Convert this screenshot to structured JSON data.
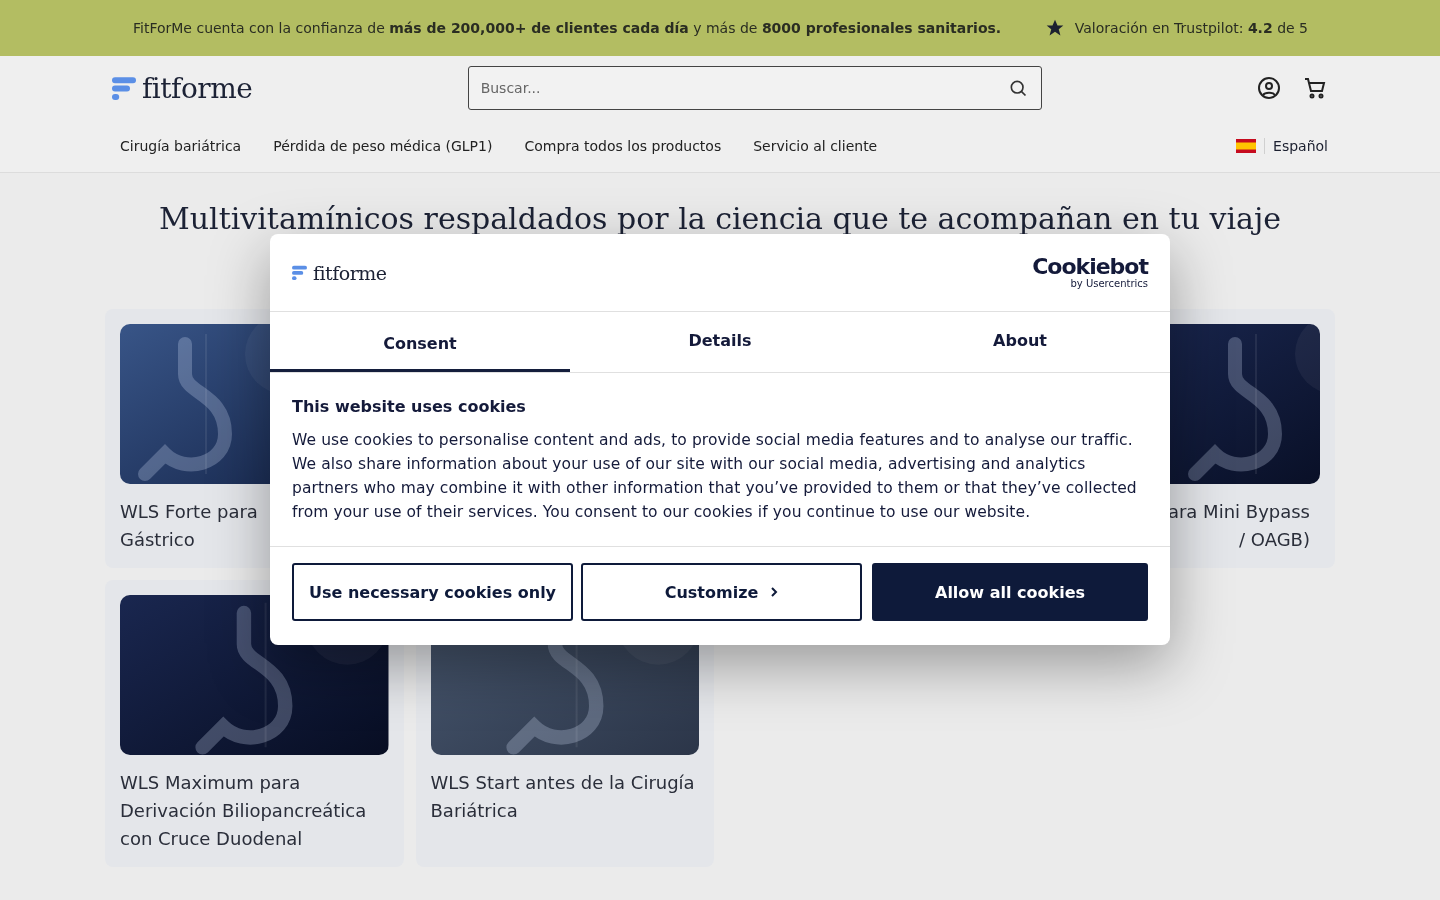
{
  "top_banner": {
    "message": "FitForMe cuenta con la confianza de **más de 200,000+ de clientes cada día** y más de **8000 profesionales sanitarios.**",
    "rating": "Valoración en Trustpilot: **4.2** de 5"
  },
  "header": {
    "logo": "fitforme",
    "search": {
      "placeholder": "Buscar..."
    }
  },
  "nav": {
    "items": [
      "Cirugía bariátrica",
      "Pérdida de peso médica (GLP1)",
      "Compra todos los productos",
      "Servicio al cliente"
    ],
    "language": "Español"
  },
  "heading": "Multivitamínicos respaldados por la ciencia que te acompañan en tu viaje",
  "product_rows": [
    {
      "cards": [
        {
          "title_lines": [
            "WLS Forte para",
            "Gástrico"
          ]
        },
        {
          "title_lines": [
            "ara Mini Bypass",
            "/ OAGB)"
          ]
        }
      ]
    },
    {
      "cards": [
        {
          "title_lines": [
            "WLS Maximum para",
            "Derivación Biliopancreática",
            "con Cruce Duodenal"
          ]
        },
        {
          "title_lines": [
            "WLS Start antes de la Cirugía",
            "Bariátrica"
          ]
        }
      ]
    }
  ],
  "cookie_dialog": {
    "logo": "fitforme",
    "provider": "Cookiebot",
    "provider_sub": "by Usercentrics",
    "tabs": [
      {
        "label": "Consent",
        "selected": true
      },
      {
        "label": "Details",
        "selected": false
      },
      {
        "label": "About",
        "selected": false
      }
    ],
    "title": "This website uses cookies",
    "body": "We use cookies to personalise content and ads, to provide social media features and to analyse our traffic. We also share information about your use of our site with our social media, advertising and analytics partners who may combine it with other information that you’ve provided to them or that they’ve collected from your use of their services. You consent to our cookies if you continue to use our website.",
    "buttons": [
      {
        "label": "Use necessary cookies only",
        "kind": "outline"
      },
      {
        "label": "Customize",
        "kind": "chevron"
      },
      {
        "label": "Allow all cookies",
        "kind": "primary"
      }
    ]
  }
}
